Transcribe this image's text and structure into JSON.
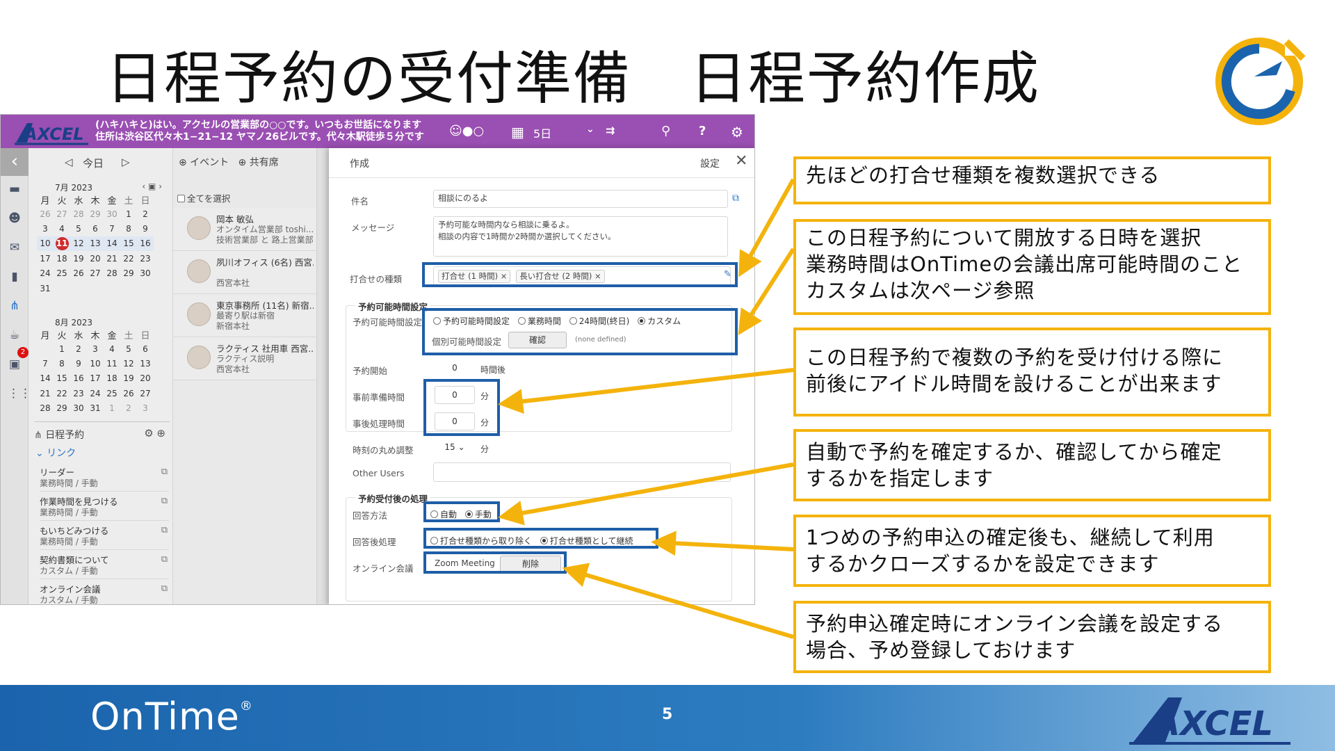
{
  "slide": {
    "title": "日程予約の受付準備　日程予約作成",
    "page_number": "5",
    "footer_brand": "OnTime",
    "footer_brand_mark": "®",
    "colors": {
      "accent_orange": "#f4b30c",
      "highlight_blue": "#1f5ea8",
      "footer_blue": "#1b64ad",
      "app_header": "#9a4fb2"
    }
  },
  "app": {
    "header": {
      "logo_text": "AXCEL",
      "message_line1": "(ハキハキと)はい。アクセルの営業部の○○です。いつもお世話になります",
      "message_line2": "住所は渋谷区代々木1−21−12 ヤマノ26ビルです。代々木駅徒歩５分です",
      "days": "5日",
      "icons": [
        "people-toggle-icon",
        "calendar-icon",
        "chevron-down-icon",
        "columns-icon",
        "search-people-icon",
        "help-icon",
        "gear-icon"
      ]
    },
    "nav": {
      "today": "今日",
      "prev": "◁",
      "next": "▷",
      "event": "⊕ イベント",
      "shared": "⊕ 共有席"
    },
    "calendar_july": {
      "title": "7月 2023",
      "weekdays": [
        "月",
        "火",
        "水",
        "木",
        "金",
        "土",
        "日"
      ],
      "weeks": [
        [
          "26",
          "27",
          "28",
          "29",
          "30",
          "1",
          "2"
        ],
        [
          "3",
          "4",
          "5",
          "6",
          "7",
          "8",
          "9"
        ],
        [
          "10",
          "11",
          "12",
          "13",
          "14",
          "15",
          "16"
        ],
        [
          "17",
          "18",
          "19",
          "20",
          "21",
          "22",
          "23"
        ],
        [
          "24",
          "25",
          "26",
          "27",
          "28",
          "29",
          "30"
        ],
        [
          "31",
          "",
          "",
          "",
          "",
          "",
          ""
        ]
      ]
    },
    "calendar_august": {
      "title": "8月 2023",
      "weekdays": [
        "月",
        "火",
        "水",
        "木",
        "金",
        "土",
        "日"
      ],
      "weeks": [
        [
          "",
          "1",
          "2",
          "3",
          "4",
          "5",
          "6"
        ],
        [
          "7",
          "8",
          "9",
          "10",
          "11",
          "12",
          "13"
        ],
        [
          "14",
          "15",
          "16",
          "17",
          "18",
          "19",
          "20"
        ],
        [
          "21",
          "22",
          "23",
          "24",
          "25",
          "26",
          "27"
        ],
        [
          "28",
          "29",
          "30",
          "31",
          "1",
          "2",
          "3"
        ]
      ]
    },
    "sidebar_badge": "2",
    "schedule_section": {
      "title": "日程予約",
      "link_header": "リンク",
      "links": [
        {
          "name": "リーダー",
          "sub": "業務時間 / 手動"
        },
        {
          "name": "作業時間を見つける",
          "sub": "業務時間 / 手動"
        },
        {
          "name": "もいちどみつける",
          "sub": "業務時間 / 手動"
        },
        {
          "name": "契約書類について",
          "sub": "カスタム / 手動"
        },
        {
          "name": "オンライン会議",
          "sub": "カスタム / 手動"
        }
      ]
    },
    "people": {
      "select_all": "全てを選択",
      "items": [
        {
          "line1": "岡本 敏弘",
          "line2": "オンタイム営業部 toshi...",
          "line3": "技術営業部 と 路上営業部"
        },
        {
          "line1": "夙川オフィス (6名) 西宮...",
          "line2": "",
          "line3": "西宮本社"
        },
        {
          "line1": "東京事務所 (11名) 新宿...",
          "line2": "最寄り駅は新宿",
          "line3": "新宿本社"
        },
        {
          "line1": "ラクティス 社用車 西宮...",
          "line2": "ラクティス説明",
          "line3": "西宮本社"
        }
      ]
    },
    "dialog": {
      "title": "作成",
      "settings": "設定",
      "subject_label": "件名",
      "subject_value": "相談にのるよ",
      "message_label": "メッセージ",
      "message_line1": "予約可能な時間内なら相談に乗るよ。",
      "message_line2": "相談の内容で1時間か2時間か選択してください。",
      "meeting_type_label": "打合せの種類",
      "meeting_types": [
        "打合せ (1 時間)",
        "長い打合せ (2 時間)"
      ],
      "availability_section": "予約可能時間設定",
      "availability_label": "予約可能時間設定",
      "availability_options": [
        "予約可能時間設定",
        "業務時間",
        "24時間(終日)",
        "カスタム"
      ],
      "individual_label": "個別可能時間設定",
      "confirm_button": "確認",
      "none_defined": "(none defined)",
      "start_label": "予約開始",
      "start_value": "0",
      "start_unit": "時間後",
      "prep_label": "事前準備時間",
      "prep_value": "0",
      "post_label": "事後処理時間",
      "post_value": "0",
      "minutes_unit": "分",
      "rounding_label": "時刻の丸め調整",
      "rounding_value": "15",
      "other_users_label": "Other Users",
      "after_section": "予約受付後の処理",
      "reply_label": "回答方法",
      "reply_options": [
        "自動",
        "手動"
      ],
      "post_reply_label": "回答後処理",
      "post_reply_options": [
        "打合せ種類から取り除く",
        "打合せ種類として継続"
      ],
      "online_label": "オンライン会議",
      "online_value": "Zoom Meeting",
      "delete_button": "削除"
    }
  },
  "callouts": [
    {
      "line1": "先ほどの打合せ種類を複数選択できる",
      "line2": "",
      "line3": ""
    },
    {
      "line1": "この日程予約について開放する日時を選択",
      "line2": "業務時間はOnTimeの会議出席可能時間のこと",
      "line3": "カスタムは次ページ参照"
    },
    {
      "line1": "この日程予約で複数の予約を受け付ける際に",
      "line2": "前後にアイドル時間を設けることが出来ます",
      "line3": ""
    },
    {
      "line1": "自動で予約を確定するか、確認してから確定",
      "line2": "するかを指定します",
      "line3": ""
    },
    {
      "line1": "1つめの予約申込の確定後も、継続して利用",
      "line2": "するかクローズするかを設定できます",
      "line3": ""
    },
    {
      "line1": "予約申込確定時にオンライン会議を設定する",
      "line2": "場合、予め登録しておけます",
      "line3": ""
    }
  ]
}
